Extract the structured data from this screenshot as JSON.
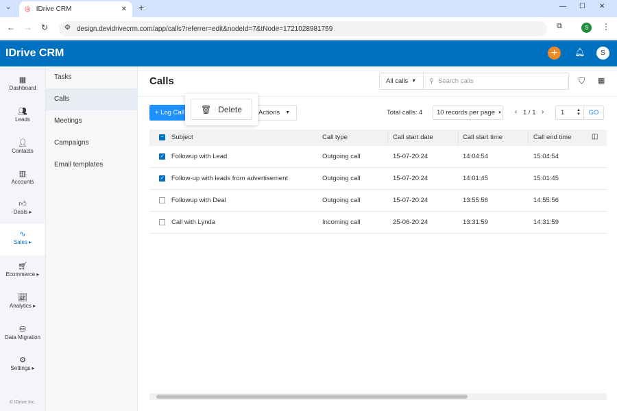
{
  "browser": {
    "tab_title": "IDrive CRM",
    "url": "design.devidrivecrm.com/app/calls?referrer=edit&nodeId=7&tNode=1721028981759",
    "profile_initial": "S"
  },
  "header": {
    "logo": "IDrive CRM",
    "user_initial": "S",
    "brand_color": "#0070c0",
    "add_color": "#f08a24"
  },
  "sidebar": {
    "items": [
      {
        "label": "Dashboard",
        "icon": "dashboard-icon"
      },
      {
        "label": "Leads",
        "icon": "leads-icon"
      },
      {
        "label": "Contacts",
        "icon": "contacts-icon"
      },
      {
        "label": "Accounts",
        "icon": "accounts-icon"
      },
      {
        "label": "Deals ▸",
        "icon": "deals-icon"
      },
      {
        "label": "Sales ▸",
        "icon": "sales-icon",
        "active": true
      },
      {
        "label": "Ecommerce ▸",
        "icon": "ecommerce-icon"
      },
      {
        "label": "Analytics ▸",
        "icon": "analytics-icon"
      },
      {
        "label": "Data Migration",
        "icon": "data-migration-icon"
      },
      {
        "label": "Settings ▸",
        "icon": "settings-icon"
      }
    ],
    "footer": "© IDrive Inc."
  },
  "submenu": {
    "items": [
      "Tasks",
      "Calls",
      "Meetings",
      "Campaigns",
      "Email templates"
    ],
    "active": "Calls"
  },
  "main": {
    "title": "Calls",
    "filter": "All calls",
    "search_placeholder": "Search calls",
    "log_call": "+ Log Call",
    "actions": "Actions",
    "delete": "Delete",
    "total": "Total calls: 4",
    "per_page": "10 records per page",
    "pagination": "1 / 1",
    "page_input": "1",
    "go": "GO",
    "columns": [
      "Subject",
      "Call type",
      "Call start date",
      "Call start time",
      "Call end time"
    ],
    "rows": [
      {
        "checked": true,
        "subject": "Followup with Lead",
        "type": "Outgoing call",
        "date": "15-07-20:24",
        "start": "14:04:54",
        "end": "15:04:54"
      },
      {
        "checked": true,
        "subject": "Follow-up with leads from advertisement",
        "type": "Outgoing call",
        "date": "15-07-20:24",
        "start": "14:01:45",
        "end": "15:01:45"
      },
      {
        "checked": false,
        "subject": "Followup with Deal",
        "type": "Outgoing call",
        "date": "15-07-20:24",
        "start": "13:55:56",
        "end": "14:55:56"
      },
      {
        "checked": false,
        "subject": "Call with Lynda",
        "type": "Incoming call",
        "date": "25-06-20:24",
        "start": "13:31:59",
        "end": "14:31:59"
      }
    ]
  }
}
